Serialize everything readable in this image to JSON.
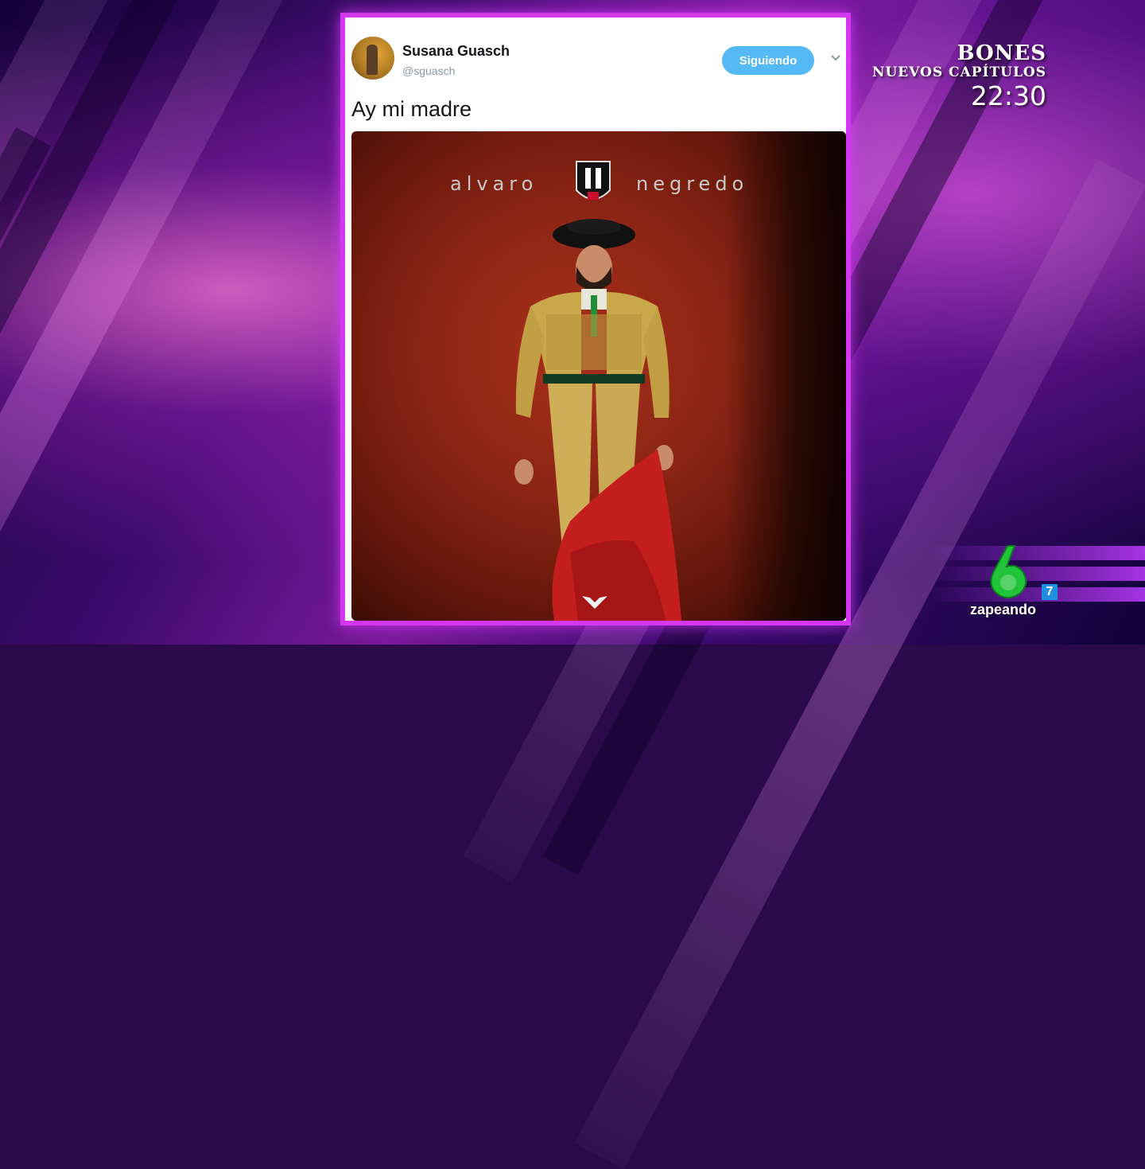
{
  "tweet": {
    "author_name": "Susana Guasch",
    "author_handle": "@sguasch",
    "follow_label": "Siguiendo",
    "text": "Ay mi madre",
    "photo": {
      "word_left": "alvaro",
      "word_right": "negredo"
    }
  },
  "tv_overlay": {
    "show_title": "BONES",
    "show_subtitle": "NUEVOS CAPÍTULOS",
    "show_time": "22:30",
    "channel_sub_badge": "7",
    "channel_brand": "zapeando"
  },
  "colors": {
    "card_border": "#d338f0",
    "follow_button": "#55b9f5",
    "channel_logo": "#22c43a"
  },
  "icons": {
    "avatar": "user-avatar",
    "chevron": "chevron-down-icon",
    "crest": "club-crest-icon",
    "channel_logo": "channel-six-logo"
  }
}
